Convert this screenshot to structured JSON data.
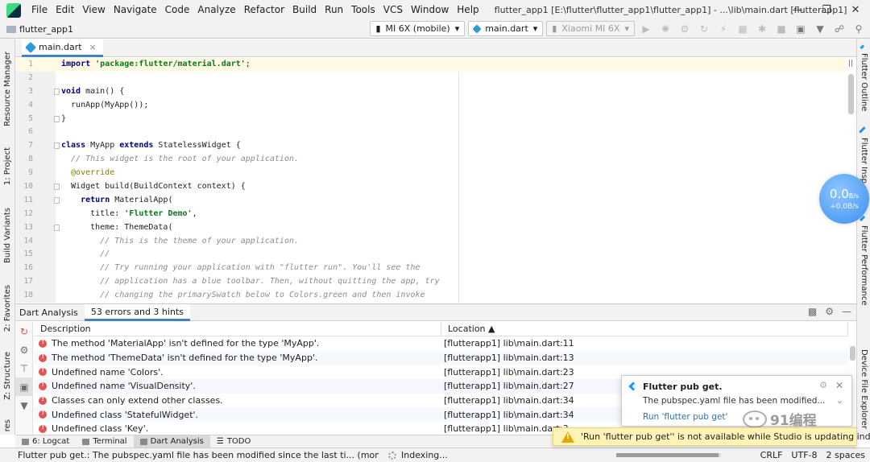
{
  "menu": [
    "File",
    "Edit",
    "View",
    "Navigate",
    "Code",
    "Analyze",
    "Refactor",
    "Build",
    "Run",
    "Tools",
    "VCS",
    "Window",
    "Help"
  ],
  "window_title": "flutter_app1 [E:\\flutter\\flutter_app1\\flutter_app1] - ...\\lib\\main.dart [flutterapp1]",
  "breadcrumb": "flutter_app1",
  "toolbar": {
    "device": "MI 6X (mobile)",
    "config": "main.dart",
    "target": "Xiaomi MI 6X"
  },
  "left_tabs": [
    "Resource Manager",
    "1: Project",
    "Build Variants",
    "2: Favorites",
    "Z: Structure",
    "res"
  ],
  "right_tabs": [
    "Flutter Outline",
    "Flutter Insp",
    "Flutter Performance",
    "Device File Explorer"
  ],
  "editor": {
    "tab": "main.dart",
    "lines": [
      {
        "n": "1",
        "segs": [
          {
            "t": "import ",
            "c": "kw"
          },
          {
            "t": "'package:flutter/material.dart'",
            "c": "str"
          },
          {
            "t": ";",
            "c": ""
          }
        ]
      },
      {
        "n": "2",
        "segs": []
      },
      {
        "n": "3",
        "segs": [
          {
            "t": "void ",
            "c": "kw"
          },
          {
            "t": "main() {",
            "c": ""
          }
        ]
      },
      {
        "n": "4",
        "segs": [
          {
            "t": "  runApp(MyApp());",
            "c": ""
          }
        ]
      },
      {
        "n": "5",
        "segs": [
          {
            "t": "}",
            "c": ""
          }
        ]
      },
      {
        "n": "6",
        "segs": []
      },
      {
        "n": "7",
        "segs": [
          {
            "t": "class ",
            "c": "kw"
          },
          {
            "t": "MyApp ",
            "c": ""
          },
          {
            "t": "extends ",
            "c": "kw"
          },
          {
            "t": "StatelessWidget {",
            "c": ""
          }
        ]
      },
      {
        "n": "8",
        "segs": [
          {
            "t": "  // This widget is the root of your application.",
            "c": "cmt"
          }
        ]
      },
      {
        "n": "9",
        "segs": [
          {
            "t": "  @override",
            "c": "ann"
          }
        ]
      },
      {
        "n": "10",
        "segs": [
          {
            "t": "  Widget build(BuildContext context) {",
            "c": ""
          }
        ]
      },
      {
        "n": "11",
        "segs": [
          {
            "t": "    ",
            "c": ""
          },
          {
            "t": "return ",
            "c": "kw"
          },
          {
            "t": "MaterialApp(",
            "c": ""
          }
        ]
      },
      {
        "n": "12",
        "segs": [
          {
            "t": "      title: ",
            "c": ""
          },
          {
            "t": "'Flutter Demo'",
            "c": "str"
          },
          {
            "t": ",",
            "c": ""
          }
        ]
      },
      {
        "n": "13",
        "segs": [
          {
            "t": "      theme: ThemeData(",
            "c": ""
          }
        ]
      },
      {
        "n": "14",
        "segs": [
          {
            "t": "        // This is the theme of your application.",
            "c": "cmt"
          }
        ]
      },
      {
        "n": "15",
        "segs": [
          {
            "t": "        //",
            "c": "cmt"
          }
        ]
      },
      {
        "n": "16",
        "segs": [
          {
            "t": "        // Try running your application with \"flutter run\". You'll see the",
            "c": "cmt"
          }
        ]
      },
      {
        "n": "17",
        "segs": [
          {
            "t": "        // application has a blue toolbar. Then, without quitting the app, try",
            "c": "cmt"
          }
        ]
      },
      {
        "n": "18",
        "segs": [
          {
            "t": "        // changing the primarySwatch below to Colors.green and then invoke",
            "c": "cmt"
          }
        ]
      }
    ]
  },
  "analysis": {
    "title": "Dart Analysis",
    "tab": "53 errors and 3 hints",
    "col_description": "Description",
    "col_location": "Location",
    "rows": [
      {
        "desc": "The method 'MaterialApp' isn't defined for the type 'MyApp'.",
        "loc": "[flutterapp1] lib\\main.dart:11"
      },
      {
        "desc": "The method 'ThemeData' isn't defined for the type 'MyApp'.",
        "loc": "[flutterapp1] lib\\main.dart:13"
      },
      {
        "desc": "Undefined name 'Colors'.",
        "loc": "[flutterapp1] lib\\main.dart:23"
      },
      {
        "desc": "Undefined name 'VisualDensity'.",
        "loc": "[flutterapp1] lib\\main.dart:27"
      },
      {
        "desc": "Classes can only extend other classes.",
        "loc": "[flutterapp1] lib\\main.dart:34"
      },
      {
        "desc": "Undefined class 'StatefulWidget'.",
        "loc": "[flutterapp1] lib\\main.dart:34"
      },
      {
        "desc": "Undefined class 'Key'.",
        "loc": "[flutterapp1] lib\\main.dart:3"
      }
    ]
  },
  "tool_tabs": [
    "6: Logcat",
    "Terminal",
    "Dart Analysis",
    "TODO"
  ],
  "status": {
    "message": "Flutter pub get.: The pubspec.yaml file has been modified since the last ti... (moments ago)",
    "indexing": "Indexing...",
    "indexing_progress": 0.98,
    "line_sep": "CRLF",
    "encoding": "UTF-8",
    "indent": "2 spaces"
  },
  "speed_widget": {
    "value": "0.0",
    "unit": "B/s",
    "sub": "+0.0B/s"
  },
  "notification": {
    "title": "Flutter pub get.",
    "body": "The pubspec.yaml file has been modified...",
    "link": "Run 'flutter pub get'"
  },
  "warning": "'Run 'flutter pub get'' is not available while Studio is updating indices",
  "watermark": "91编程"
}
